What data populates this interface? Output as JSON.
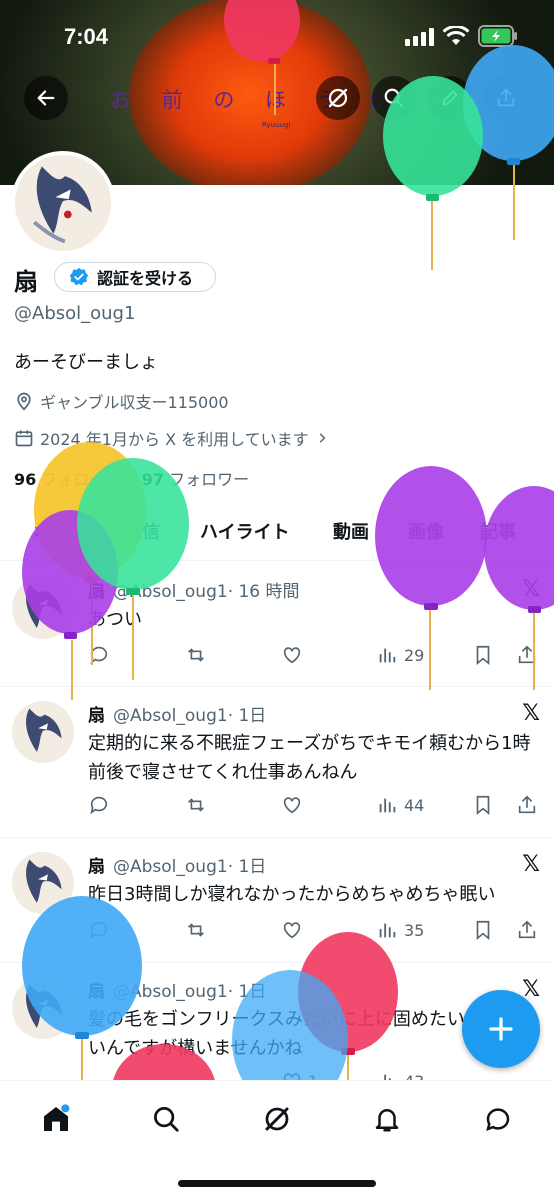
{
  "status_bar": {
    "time": "7:04"
  },
  "banner": {
    "title": "お 前 の ほ う が 怖",
    "subtitle": "Ryuuugi"
  },
  "profile": {
    "name": "扇",
    "verify_label": "認証を受ける",
    "handle": "@Absol_oug1",
    "bio": "あーそびーましょ",
    "location": "ギャンブル収支ー115000",
    "joined": "2024 年1月から X を利用しています",
    "following_count": "96",
    "following_label": "フォロー中",
    "followers_count": "97",
    "followers_label": "フォロワー"
  },
  "tabs": [
    "ポスト",
    "返信",
    "ハイライト",
    "動画",
    "画像",
    "記事"
  ],
  "posts": [
    {
      "name": "扇",
      "handle": "@Absol_oug1",
      "time": "· 16 時間",
      "text": "あつい",
      "views": "29"
    },
    {
      "name": "扇",
      "handle": "@Absol_oug1",
      "time": "· 1日",
      "text": "定期的に来る不眠症フェーズがちでキモイ頼むから1時前後で寝させてくれ仕事あんねん",
      "views": "44"
    },
    {
      "name": "扇",
      "handle": "@Absol_oug1",
      "time": "· 1日",
      "text": "昨日3時間しか寝れなかったからめちゃめちゃ眠い",
      "views": "35"
    },
    {
      "name": "扇",
      "handle": "@Absol_oug1",
      "time": "· 1日",
      "text": "髪の毛をゴンフリークスみたいに上に固めたいを盛りたいんですが構いませんかね",
      "views": "43",
      "likes": "1"
    }
  ],
  "colors": {
    "accent": "#1d9bf0",
    "text": "#0f1419",
    "secondary": "#536471"
  },
  "icons": [
    "back-icon",
    "grok-icon",
    "search-icon",
    "edit-icon",
    "share-icon",
    "verified-badge-icon",
    "location-icon",
    "calendar-icon",
    "reply-icon",
    "repost-icon",
    "like-icon",
    "views-icon",
    "bookmark-icon",
    "x-logo-icon",
    "plus-icon",
    "home-icon",
    "notifications-icon",
    "messages-icon"
  ]
}
